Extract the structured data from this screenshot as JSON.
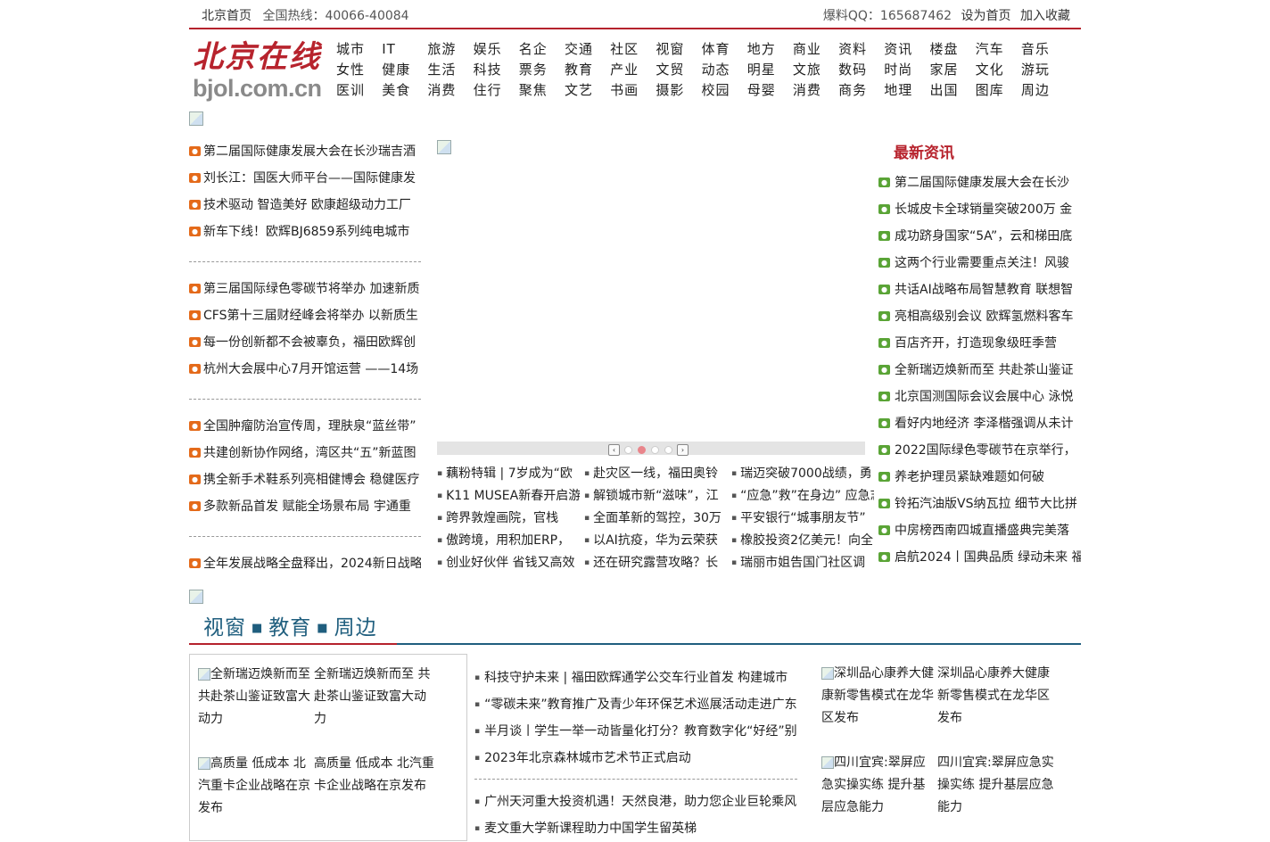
{
  "topbar": {
    "home": "北京首页",
    "hotline_label": "全国热线：40066-40084",
    "qq": "爆料QQ：165687462",
    "set_home": "设为首页",
    "favorite": "加入收藏"
  },
  "logo": {
    "cn": "北京在线",
    "en": "bjol.com.cn"
  },
  "nav": [
    [
      "城市",
      "IT",
      "旅游",
      "娱乐",
      "名企",
      "交通",
      "社区",
      "视窗",
      "体育",
      "地方",
      "商业",
      "资料",
      "资讯",
      "楼盘",
      "汽车",
      "音乐"
    ],
    [
      "女性",
      "健康",
      "生活",
      "科技",
      "票务",
      "教育",
      "产业",
      "文贸",
      "动态",
      "明星",
      "文旅",
      "数码",
      "时尚",
      "家居",
      "文化",
      "游玩"
    ],
    [
      "医训",
      "美食",
      "消费",
      "住行",
      "聚焦",
      "文艺",
      "书画",
      "摄影",
      "校园",
      "母婴",
      "消费",
      "商务",
      "地理",
      "出国",
      "图库",
      "周边"
    ]
  ],
  "left_news": [
    [
      "第二届国际健康发展大会在长沙瑞吉酒",
      "刘长江：国医大师平台——国际健康发",
      "技术驱动 智造美好 欧康超级动力工厂",
      "新车下线！欧辉BJ6859系列纯电城市"
    ],
    [
      "第三届国际绿色零碳节将举办 加速新质",
      "CFS第十三届财经峰会将举办 以新质生",
      "每一份创新都不会被辜负，福田欧辉创",
      "杭州大会展中心7月开馆运营 ——14场"
    ],
    [
      "全国肿瘤防治宣传周，理肤泉“蓝丝带”",
      "共建创新协作网络，湾区共“五”新蓝图",
      "携全新手术鞋系列亮相健博会 稳健医疗",
      "多款新品首发 赋能全场景布局 宇通重"
    ],
    [
      "全年发展战略全盘释出，2024新日战略"
    ]
  ],
  "grid": [
    [
      "藕粉特辑 | 7岁成为“欧",
      "K11 MUSEA新春开启游",
      "跨界敦煌画院，官栈",
      "傲跨境，用积加ERP，",
      "创业好伙伴 省钱又高效"
    ],
    [
      "赴灾区一线，福田奥铃",
      "解锁城市新“滋味”，江",
      "全面革新的驾控，30万",
      "以AI抗疫，华为云荣获",
      "还在研究露营攻略？长"
    ],
    [
      "瑞迈突破7000战绩，勇",
      "“应急”救”在身边” 应急志",
      "平安银行“城事朋友节”",
      "橡胶投资2亿美元！向全",
      "瑞丽市姐告国门社区调"
    ]
  ],
  "latest": {
    "title": "最新资讯",
    "items": [
      "第二届国际健康发展大会在长沙",
      "长城皮卡全球销量突破200万 金",
      "成功跻身国家“5A”，云和梯田底",
      "这两个行业需要重点关注！风骏",
      "共话AI战略布局智慧教育 联想智",
      "亮相高级别会议 欧辉氢燃料客车",
      "百店齐开，打造现象级旺季营",
      "全新瑞迈焕新而至 共赴茶山鉴证",
      "北京国测国际会议会展中心 泳悦",
      "看好内地经济 李泽楷强调从未计",
      "2022国际绿色零碳节在京举行，",
      "养老护理员紧缺难题如何破",
      "铃拓汽油版VS纳瓦拉 细节大比拼",
      "中房榜西南四城直播盛典完美落",
      "启航2024丨国典品质 绿动未来 福"
    ]
  },
  "section": {
    "title_parts": [
      "视窗",
      "教育",
      "周边"
    ],
    "box": [
      {
        "alt": "全新瑞迈焕新而至 共赴茶山鉴证致富大动力",
        "caption": "全新瑞迈焕新而至 共赴茶山鉴证致富大动力"
      },
      {
        "alt": "高质量 低成本 北汽重卡企业战略在京发布",
        "caption": "高质量 低成本 北汽重卡企业战略在京发布"
      }
    ],
    "mid_list_1": [
      "科技守护未来 | 福田欧辉通学公交车行业首发 构建城市",
      "“零碳未来”教育推广及青少年环保艺术巡展活动走进广东",
      "半月谈丨学生一举一动皆量化打分？教育数字化“好经”别",
      "2023年北京森林城市艺术节正式启动"
    ],
    "mid_list_2": [
      "广州天河重大投资机遇！天然良港，助力您企业巨轮乘风",
      "麦文重大学新课程助力中国学生留英梯"
    ],
    "right": [
      {
        "alt": "深圳品心康养大健康新零售模式在龙华区发布",
        "caption": "深圳品心康养大健康新零售模式在龙华区发布"
      },
      {
        "alt": "四川宜宾:翠屏应急实操实练 提升基层应急能力",
        "caption": "四川宜宾:翠屏应急实操实练 提升基层应急能力"
      }
    ]
  },
  "slide": {
    "active_dot": 1,
    "dot_count": 4
  }
}
